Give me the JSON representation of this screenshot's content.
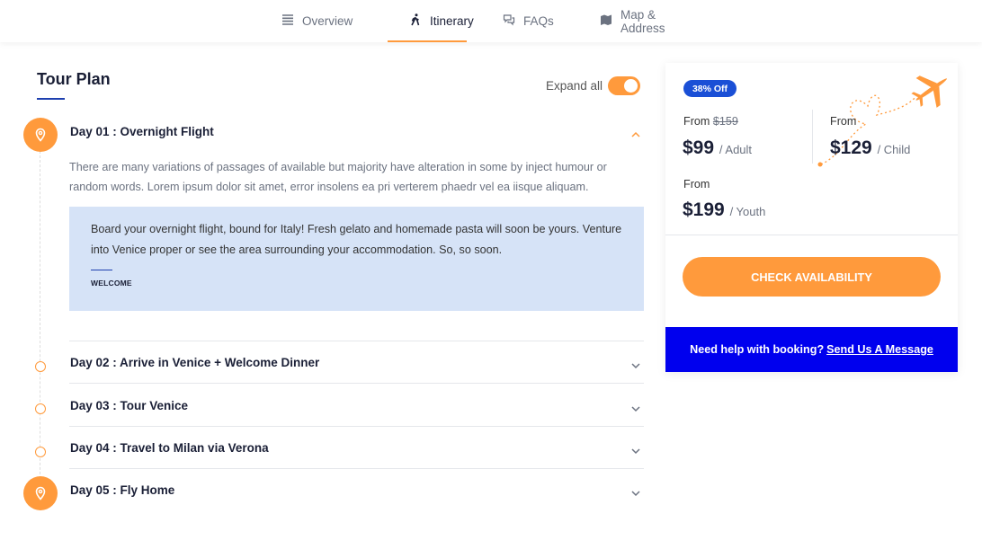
{
  "tabs": [
    {
      "label": "Overview",
      "icon": "list-icon"
    },
    {
      "label": "Itinerary",
      "icon": "hiker-icon",
      "active": true
    },
    {
      "label": "FAQs",
      "icon": "chat-icon"
    },
    {
      "label": "Map & Address",
      "icon": "map-icon"
    }
  ],
  "tour": {
    "title": "Tour Plan",
    "expand_label": "Expand all",
    "days": [
      {
        "title": "Day 01 : Overnight Flight",
        "expanded": true,
        "description": "There are many variations of passages of available but majority have alteration in some by inject humour or random words. Lorem ipsum dolor sit amet, error insolens ea pri verterem phaedr vel ea iisque aliquam.",
        "quote": "Board your overnight flight, bound for Italy! Fresh gelato and homemade pasta will soon be yours. Venture into Venice proper or see the area surrounding your accommodation. So, so soon.",
        "quote_label": "WELCOME"
      },
      {
        "title": "Day 02 : Arrive in Venice + Welcome Dinner"
      },
      {
        "title": "Day 03 : Tour Venice"
      },
      {
        "title": "Day 04 : Travel to Milan via Verona"
      },
      {
        "title": "Day 05 : Fly Home"
      }
    ]
  },
  "booking": {
    "badge": "38% Off",
    "adult": {
      "from": "From",
      "old": "$159",
      "price": "$99",
      "unit": "/ Adult"
    },
    "child": {
      "from": "From",
      "price": "$129",
      "unit": "/ Child"
    },
    "youth": {
      "from": "From",
      "price": "$199",
      "unit": "/ Youth"
    },
    "cta": "CHECK AVAILABILITY",
    "help_text": "Need help with booking?",
    "help_link": "Send Us A Message"
  },
  "colors": {
    "accent": "#ff9a3c",
    "primary": "#1a4fd6",
    "help_bg": "#0000ee",
    "quote_bg": "#d6e3f7"
  }
}
